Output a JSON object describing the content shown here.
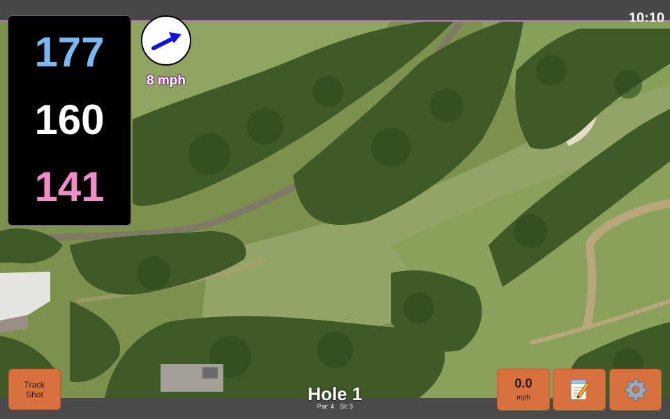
{
  "status_bar": {
    "time": "10:10"
  },
  "yardages": {
    "back": "177",
    "middle": "160",
    "front": "141"
  },
  "wind": {
    "speed_label": "8 mph",
    "arrow_icon": "wind-arrow-icon"
  },
  "buttons": {
    "track_shot_line1": "Track",
    "track_shot_line2": "Shot",
    "speed_value": "0.0",
    "speed_unit": "mph",
    "notes_icon": "notepad-icon",
    "settings_icon": "gear-icon"
  },
  "hole": {
    "title": "Hole 1",
    "par": "Par: 4",
    "si": "SI: 3"
  },
  "colors": {
    "back_yardage": "#7ab8f5",
    "middle_yardage": "#ffffff",
    "front_yardage": "#f08cc8",
    "button_orange": "#d9713f",
    "wind_arrow": "#1010e0"
  }
}
